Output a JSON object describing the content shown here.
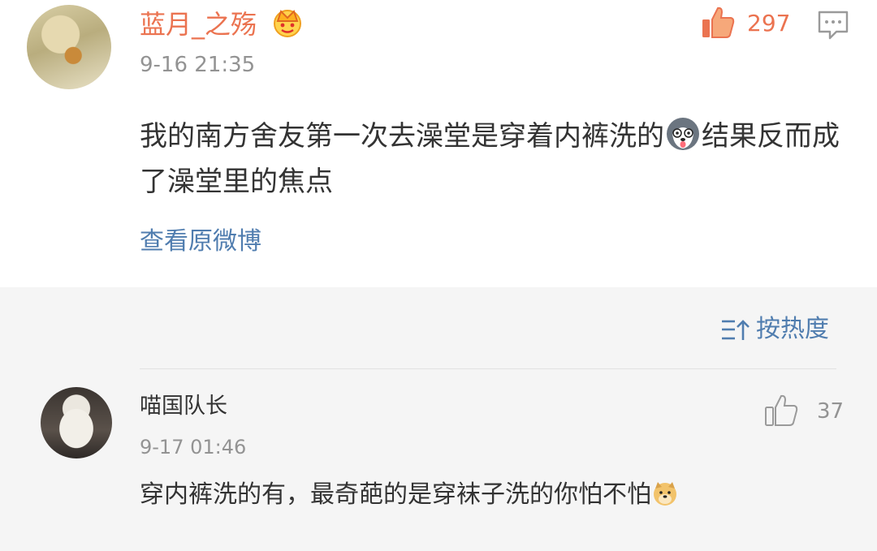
{
  "main_comment": {
    "username": "蓝月_之殇",
    "badge_icon": "crown-icon",
    "time": "9-16 21:35",
    "like_count": "297",
    "content_part1": "我的南方舍友第一次去澡堂是穿着内裤洗的",
    "emoji": "husky-emoji",
    "content_part2": "结果反而成了澡堂里的焦点",
    "view_original": "查看原微博",
    "accent_color": "#eb7350",
    "link_color": "#507daf"
  },
  "sort": {
    "label": "按热度",
    "icon": "sort-icon"
  },
  "reply": {
    "username": "喵国队长",
    "time": "9-17 01:46",
    "like_count": "37",
    "content": "穿内裤洗的有，最奇葩的是穿袜子洗的你怕不怕",
    "emoji": "doge-emoji"
  }
}
